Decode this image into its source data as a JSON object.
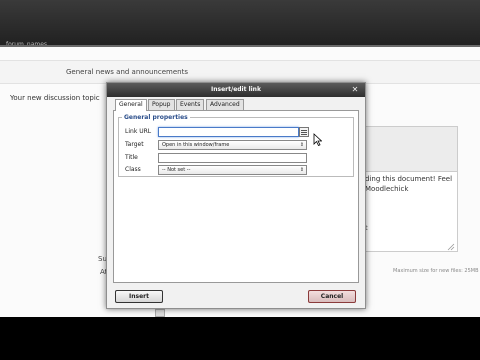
{
  "site": {
    "breadcrumb": "forum_names"
  },
  "page": {
    "forum_name": "General news and announcements",
    "discussion_label": "Your new discussion topic",
    "editor_text_lines": [
      "ding this document! Feel",
      "Moodlechick"
    ],
    "editor_status_char": "t",
    "max_size_note": "Maximum size for new files: 25MB",
    "left_fragment_1": "Su",
    "left_fragment_2": "At"
  },
  "dialog": {
    "title": "Insert/edit link",
    "tabs": [
      {
        "label": "General",
        "active": true
      },
      {
        "label": "Popup",
        "active": false
      },
      {
        "label": "Events",
        "active": false
      },
      {
        "label": "Advanced",
        "active": false
      }
    ],
    "fieldset_legend": "General properties",
    "fields": {
      "link_url": {
        "label": "Link URL",
        "value": ""
      },
      "target": {
        "label": "Target",
        "value": "Open in this window/frame"
      },
      "title": {
        "label": "Title",
        "value": ""
      },
      "class": {
        "label": "Class",
        "value": "-- Not set --"
      }
    },
    "insert_label": "Insert",
    "cancel_label": "Cancel",
    "close_icon": "close-icon",
    "browse_icon": "browse-icon"
  }
}
